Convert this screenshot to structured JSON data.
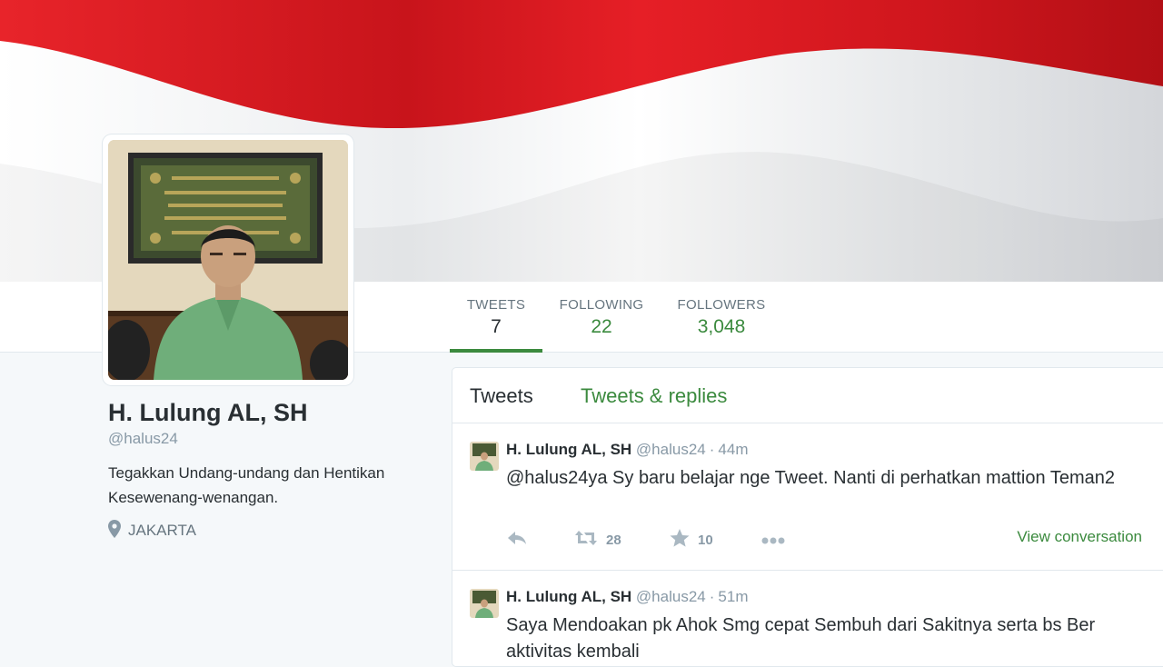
{
  "profile": {
    "name": "H. Lulung AL, SH",
    "handle": "@halus24",
    "bio": "Tegakkan Undang-undang dan Hentikan Kesewenang-wenangan.",
    "location": "JAKARTA"
  },
  "stats": [
    {
      "label": "TWEETS",
      "value": "7",
      "active": true
    },
    {
      "label": "FOLLOWING",
      "value": "22",
      "active": false
    },
    {
      "label": "FOLLOWERS",
      "value": "3,048",
      "active": false
    }
  ],
  "timeline": {
    "tabs": [
      "Tweets",
      "Tweets & replies"
    ],
    "tweets": [
      {
        "name": "H. Lulung AL, SH",
        "handle": "@halus24",
        "time": "44m",
        "text": "@halus24ya Sy baru belajar nge Tweet. Nanti di perhatkan mattion Teman2",
        "retweets": "28",
        "favorites": "10",
        "view_conversation": "View conversation"
      },
      {
        "name": "H. Lulung AL, SH",
        "handle": "@halus24",
        "time": "51m",
        "text": "Saya Mendoakan pk Ahok Smg cepat Sembuh dari Sakitnya serta bs Ber aktivitas kembali"
      }
    ]
  },
  "colors": {
    "accent": "#3b8a3e",
    "flag_red": "#e01b22",
    "flag_white": "#f4f4f6"
  },
  "icons": [
    "reply-icon",
    "retweet-icon",
    "favorite-star-icon",
    "more-icon",
    "location-pin-icon"
  ]
}
